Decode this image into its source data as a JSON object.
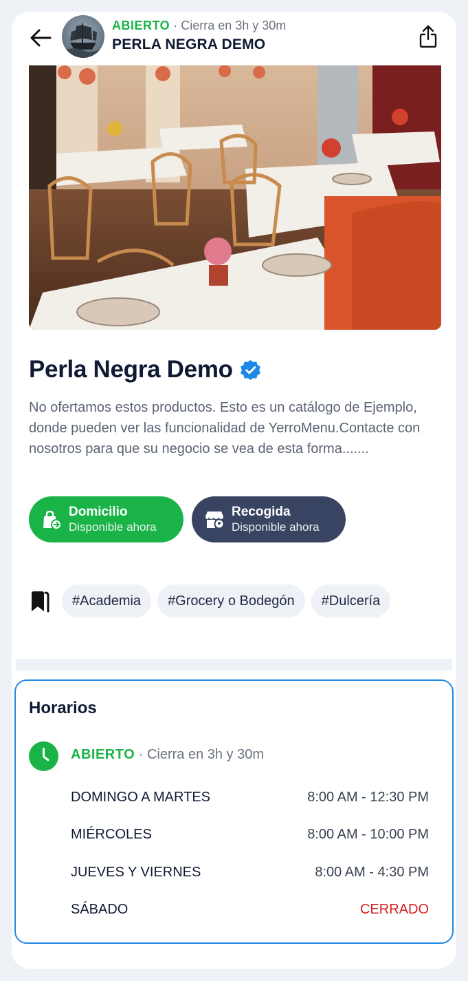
{
  "header": {
    "status_open": "ABIERTO",
    "status_separator": "·",
    "status_closes": "Cierra en 3h y 30m",
    "business_name": "PERLA NEGRA DEMO"
  },
  "business": {
    "title": "Perla Negra Demo",
    "description": "No ofertamos estos productos. Esto es un catálogo de Ejemplo, donde pueden ver las funcionalidad de YerroMenu.Contacte con nosotros para que su negocio se vea de esta forma......."
  },
  "services": [
    {
      "title": "Domicilio",
      "subtitle": "Disponible ahora",
      "color": "#19b347"
    },
    {
      "title": "Recogida",
      "subtitle": "Disponible ahora",
      "color": "#384461"
    }
  ],
  "tags": [
    "#Academia",
    "#Grocery o Bodegón",
    "#Dulcería"
  ],
  "hours": {
    "title": "Horarios",
    "status_open": "ABIERTO",
    "status_separator": "·",
    "status_closes": "Cierra en 3h y 30m",
    "rows": [
      {
        "day": "DOMINGO A MARTES",
        "time": "8:00 AM - 12:30 PM"
      },
      {
        "day": "MIÉRCOLES",
        "time": "8:00 AM - 10:00 PM"
      },
      {
        "day": "JUEVES Y VIERNES",
        "time": "8:00 AM - 4:30 PM"
      },
      {
        "day": "SÁBADO",
        "time": "CERRADO"
      }
    ]
  },
  "colors": {
    "open_green": "#19b347",
    "navy": "#384461",
    "accent_blue": "#1e88e5",
    "closed_red": "#d32020"
  }
}
